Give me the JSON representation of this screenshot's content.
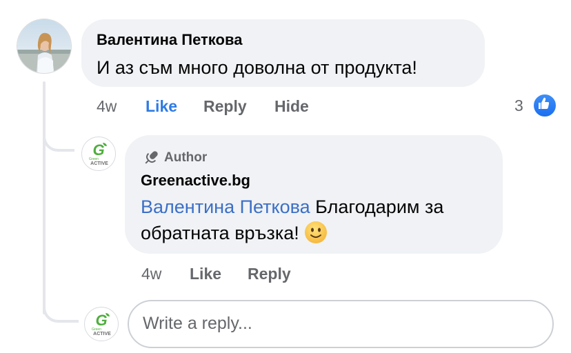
{
  "comment": {
    "author": "Валентина Петкова",
    "text": "И аз съм много доволна от продукта!",
    "time": "4w",
    "like_label": "Like",
    "reply_label": "Reply",
    "hide_label": "Hide",
    "reaction_count": "3",
    "like_color": "#2e7be4"
  },
  "reply": {
    "badge_icon": "microphone-icon",
    "badge_label": "Author",
    "author": "Greenactive.bg",
    "mention": "Валентина Петкова",
    "text_line1": " Благодарим за",
    "text_line2": "обратната връзка!",
    "emoji_icon": "slightly-smiling-face-icon",
    "time": "4w",
    "like_label": "Like",
    "reply_label": "Reply"
  },
  "brand_logo": {
    "letter": "G",
    "small_text": "Green",
    "word": "ACTIVE",
    "color": "#4fae3e"
  },
  "composer": {
    "placeholder": "Write a reply..."
  }
}
